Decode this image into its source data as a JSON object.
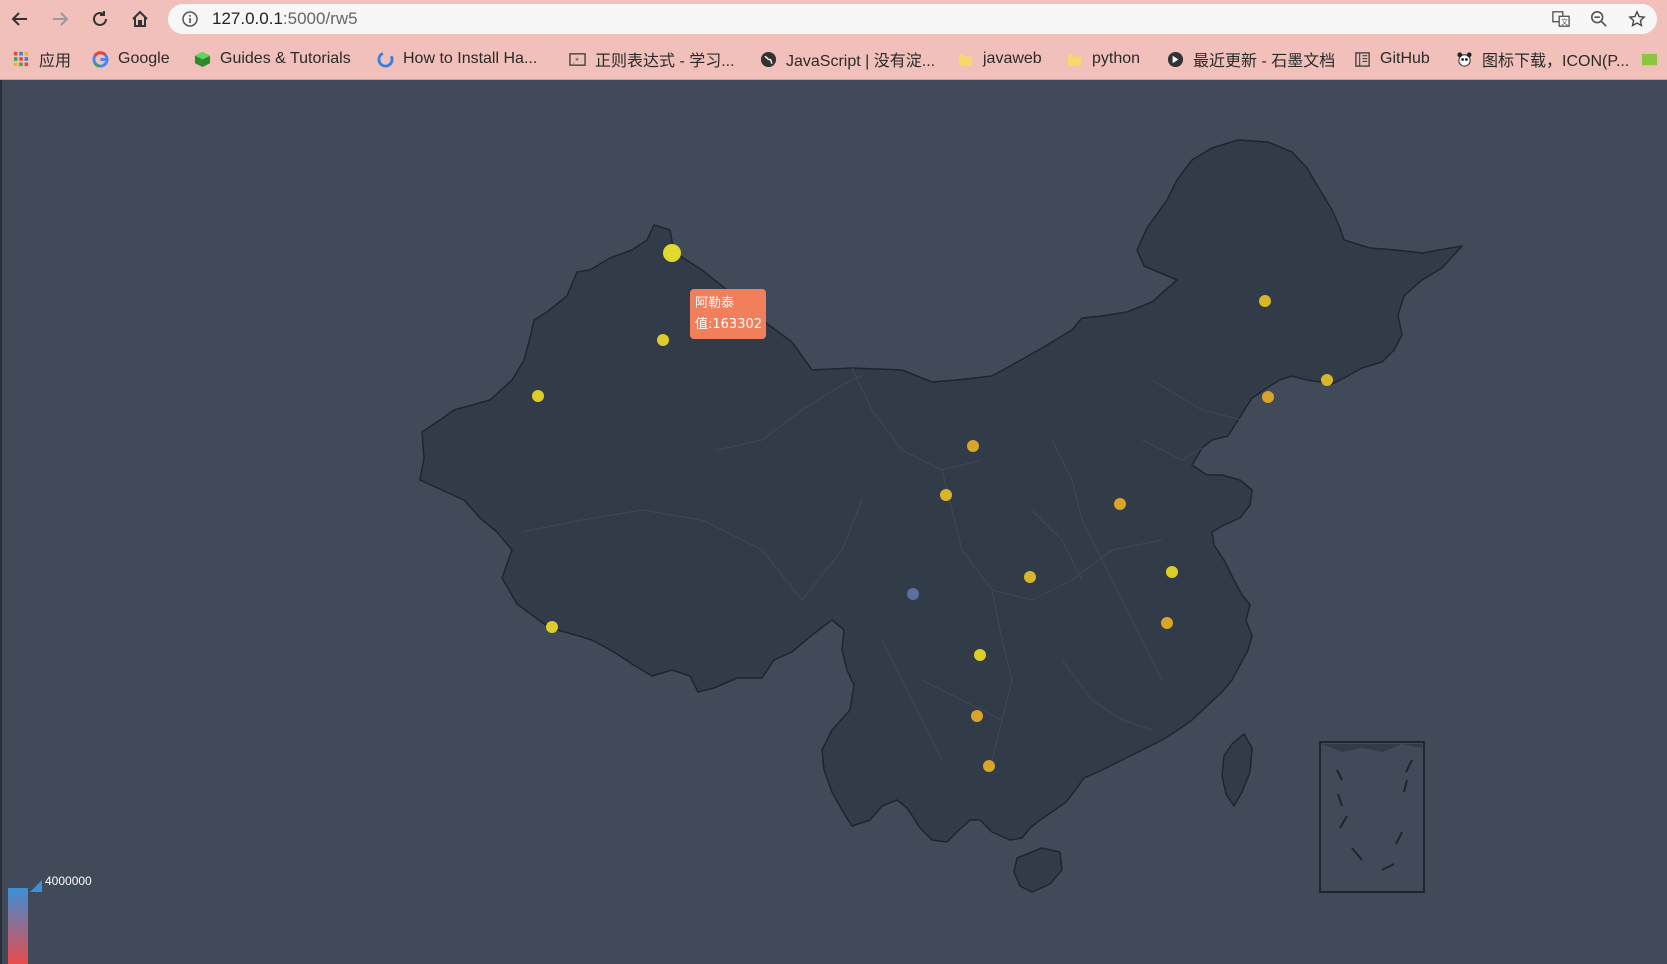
{
  "browser": {
    "url_host": "127.0.0.1",
    "url_path": ":5000/rw5",
    "bookmarks": [
      {
        "label": "应用",
        "icon": "apps-grid-icon"
      },
      {
        "label": "Google",
        "icon": "google-icon"
      },
      {
        "label": "Guides & Tutorials",
        "icon": "green-cube-icon"
      },
      {
        "label": "How to Install Ha...",
        "icon": "swirl-icon"
      },
      {
        "label": "正则表达式 - 学习...",
        "icon": "regex-box-icon"
      },
      {
        "label": "JavaScript | 没有淀...",
        "icon": "globe-icon"
      },
      {
        "label": "javaweb",
        "icon": "folder-icon"
      },
      {
        "label": "python",
        "icon": "folder-icon"
      },
      {
        "label": "最近更新 - 石墨文档",
        "icon": "shimo-icon"
      },
      {
        "label": "GitHub",
        "icon": "book-icon"
      },
      {
        "label": "图标下载，ICON(P...",
        "icon": "panda-icon"
      }
    ]
  },
  "map": {
    "tooltip": {
      "name": "阿勒泰",
      "value_label": "值:163302"
    },
    "visual_map": {
      "max_label": "4000000",
      "colors": [
        "#3d8fd6",
        "#e84b4b"
      ]
    },
    "colors": {
      "background": "#404a59",
      "land": "#323c48",
      "border": "#1f2430",
      "point_yellow": "#dccd2a",
      "point_orange": "#d9a42a",
      "point_blue": "#5c6fa0"
    },
    "points": [
      {
        "name": "阿勒泰",
        "value": 163302
      }
    ]
  }
}
